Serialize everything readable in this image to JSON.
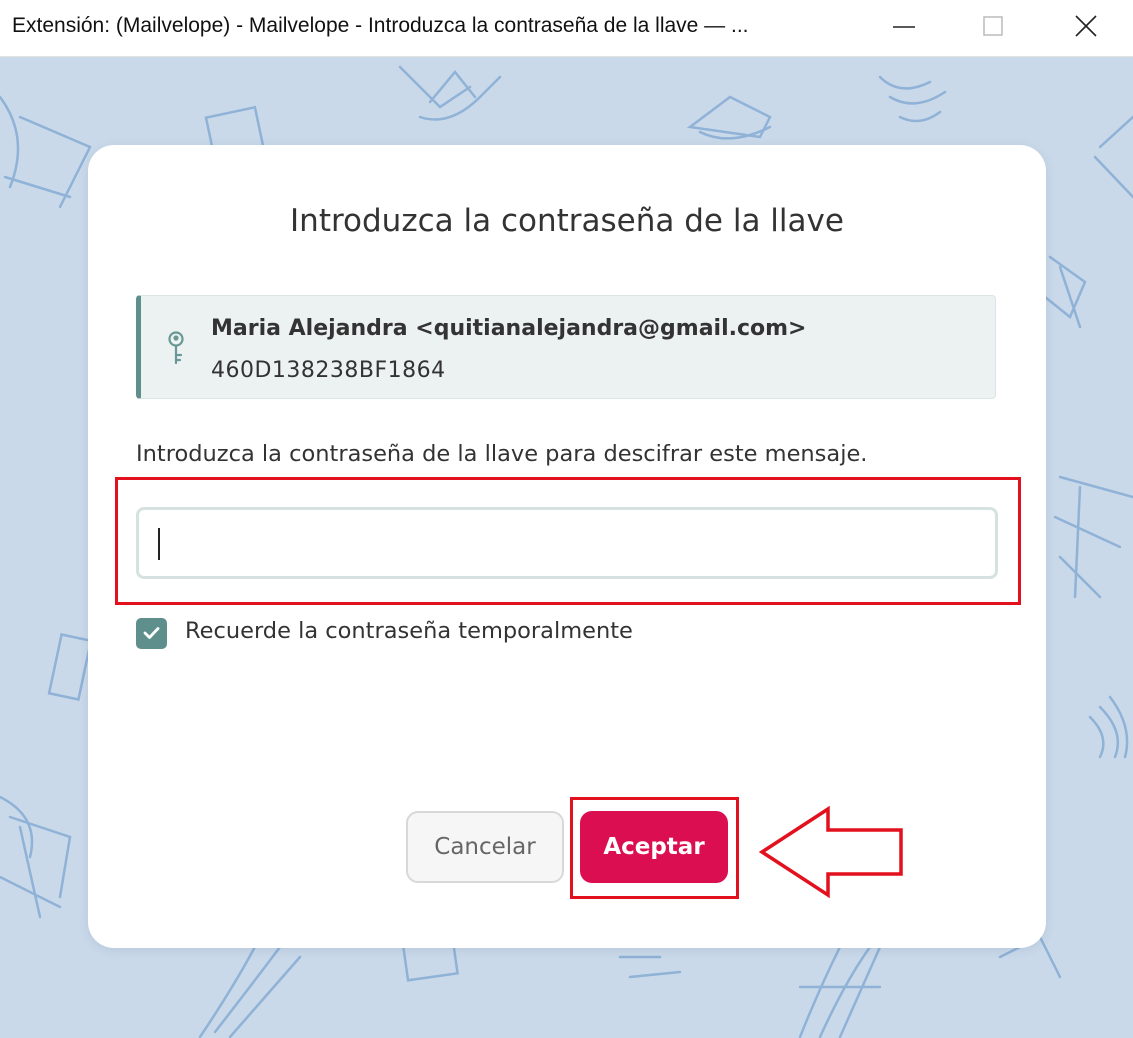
{
  "window": {
    "title": "Extensión: (Mailvelope) - Mailvelope - Introduzca la contraseña de la llave — ...",
    "controls": [
      "minimize-icon",
      "maximize-icon",
      "close-icon"
    ]
  },
  "dialog": {
    "title": "Introduzca la contraseña de la llave",
    "key": {
      "icon": "key-icon",
      "name": "Maria Alejandra <quitianalejandra@gmail.com>",
      "id": "460D138238BF1864"
    },
    "prompt": "Introduzca la contraseña de la llave para descifrar este mensaje.",
    "password": {
      "value": "",
      "placeholder": ""
    },
    "remember": {
      "label": "Recuerde la contraseña temporalmente",
      "checked": true
    },
    "buttons": {
      "cancel": "Cancelar",
      "accept": "Aceptar"
    }
  },
  "colors": {
    "accent": "#5f8f8d",
    "primary_button": "#dc0e52",
    "backdrop": "#c9d9ea",
    "annotation": "#e3101e"
  }
}
